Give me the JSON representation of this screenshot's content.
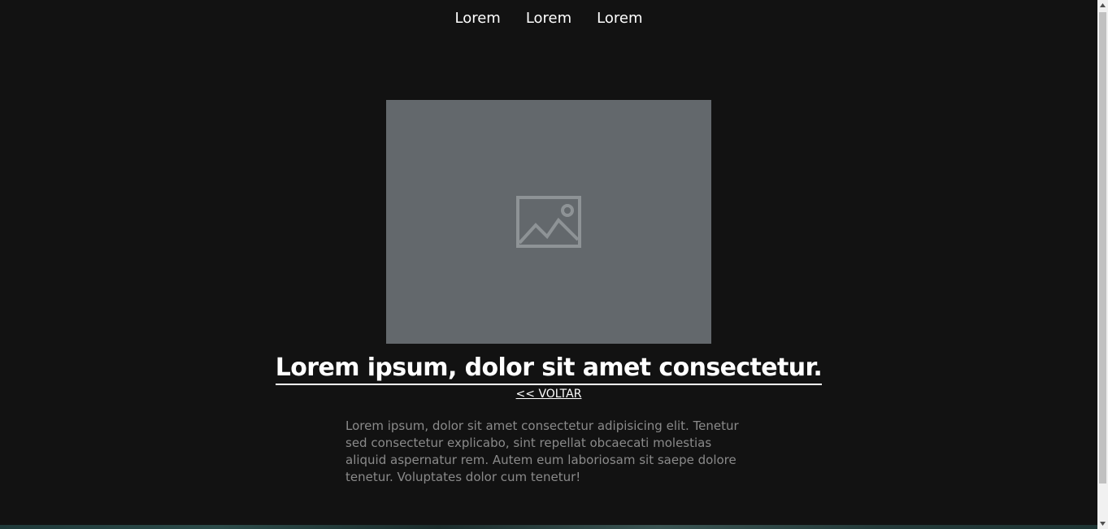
{
  "nav": {
    "items": [
      {
        "label": "Lorem"
      },
      {
        "label": "Lorem"
      },
      {
        "label": "Lorem"
      }
    ]
  },
  "hero": {
    "image_icon": "image-placeholder-icon",
    "image_bg_color": "#63686c"
  },
  "article": {
    "title": "Lorem ipsum, dolor sit amet consectetur.",
    "back_label": "<< VOLTAR",
    "body": "Lorem ipsum, dolor sit amet consectetur adipisicing elit. Tenetur sed consectetur explicabo, sint repellat obcaecati molestias aliquid aspernatur rem. Autem eum laboriosam sit saepe dolore tenetur. Voluptates dolor cum tenetur!"
  },
  "colors": {
    "background": "#121212",
    "text_primary": "#ffffff",
    "text_secondary": "#8a8a8a"
  }
}
